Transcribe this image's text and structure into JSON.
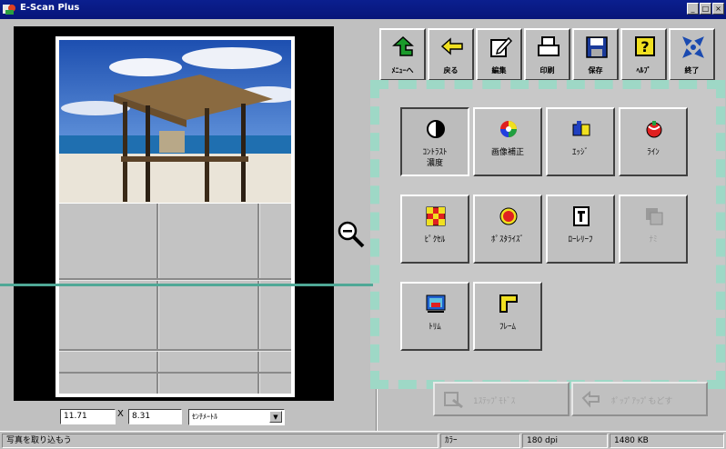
{
  "window": {
    "title": "E-Scan Plus"
  },
  "title_buttons": [
    "_",
    "□",
    "×"
  ],
  "toolbar": [
    {
      "label": "ﾒﾆｭｰへ",
      "icon": "back-arrow-icon"
    },
    {
      "label": "戻る",
      "icon": "left-arrow-icon"
    },
    {
      "label": "編集",
      "icon": "edit-icon"
    },
    {
      "label": "印刷",
      "icon": "printer-icon"
    },
    {
      "label": "保存",
      "icon": "floppy-disk-icon"
    },
    {
      "label": "ﾍﾙﾌﾟ",
      "icon": "help-icon"
    },
    {
      "label": "終了",
      "icon": "exit-icon"
    }
  ],
  "tools": [
    {
      "label": "ｺﾝﾄﾗｽﾄ\n濃度",
      "icon": "contrast-icon",
      "state": "active"
    },
    {
      "label": "画像補正",
      "icon": "color-wheel-icon",
      "state": "normal"
    },
    {
      "label": "ｴｯｼﾞ",
      "icon": "edge-icon",
      "state": "normal"
    },
    {
      "label": "ﾗｲﾝ",
      "icon": "line-icon",
      "state": "normal"
    },
    {
      "label": "ﾋﾟｸｾﾙ",
      "icon": "pixel-icon",
      "state": "normal"
    },
    {
      "label": "ﾎﾟｽﾀﾗｲｽﾞ",
      "icon": "posterize-icon",
      "state": "normal"
    },
    {
      "label": "ﾛｰﾚﾘｰﾌ",
      "icon": "low-relief-icon",
      "state": "normal"
    },
    {
      "label": "ﾅﾐ",
      "icon": "wave-icon",
      "state": "disabled"
    },
    {
      "label": "ﾄﾘﾑ",
      "icon": "trim-icon",
      "state": "normal"
    },
    {
      "label": "ﾌﾚｰﾑ",
      "icon": "frame-icon",
      "state": "normal"
    }
  ],
  "actions": [
    {
      "label": "1ｽﾃｯﾌﾟﾓﾄﾞｽ"
    },
    {
      "label": "ﾎﾟｯﾌﾟｱｯﾌﾟもどす"
    }
  ],
  "coords": {
    "x": "11.71",
    "sep": "X",
    "y": "8.31",
    "unit": "ｾﾝﾁﾒｰﾄﾙ",
    "unit_arrow": "▼"
  },
  "status": {
    "message": "写真を取り込もう",
    "color": "ｶﾗｰ",
    "dpi": "180 dpi",
    "size": "1480 KB"
  },
  "colors": {
    "titlebar": "#0b1f8f",
    "dashed_border": "#9ed8c6",
    "pointer_line": "#4fa896",
    "window_bg": "#c0c0c0"
  }
}
